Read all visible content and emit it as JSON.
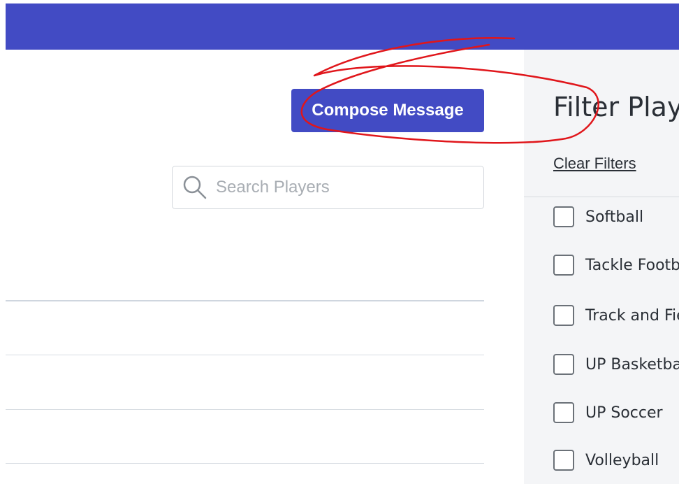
{
  "header": {},
  "main": {
    "compose_label": "Compose Message",
    "search_placeholder": "Search Players",
    "rows": [
      {},
      {},
      {},
      {}
    ]
  },
  "sidebar": {
    "title": "Filter Players",
    "clear_filters": "Clear Filters",
    "filters": [
      {
        "label": "Softball",
        "checked": false
      },
      {
        "label": "Tackle Football",
        "checked": false
      },
      {
        "label": "Track and Field",
        "checked": false
      },
      {
        "label": "UP Basketball",
        "checked": false
      },
      {
        "label": "UP Soccer",
        "checked": false
      },
      {
        "label": "Volleyball",
        "checked": false
      }
    ]
  },
  "colors": {
    "accent": "#424bc4",
    "annotation": "#e0161b",
    "sidebar_bg": "#f4f5f7"
  }
}
